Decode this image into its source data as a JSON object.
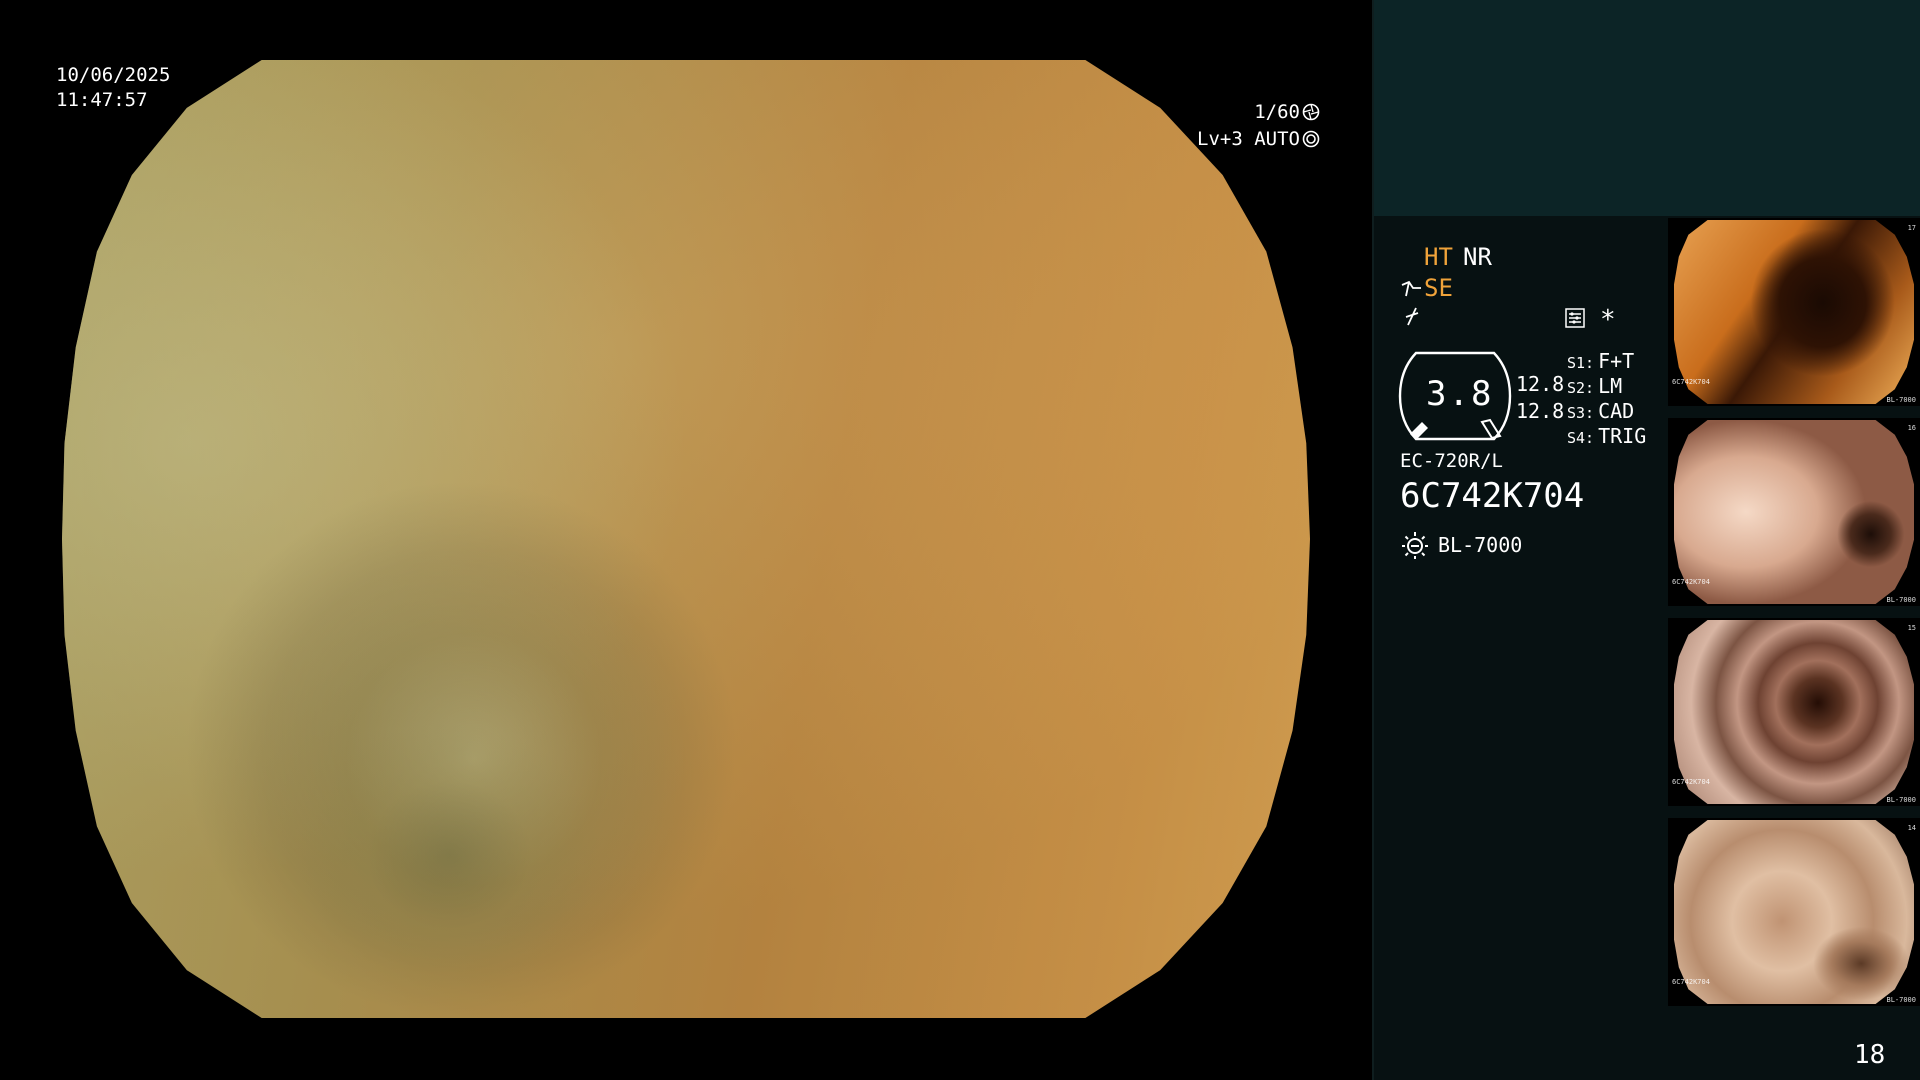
{
  "osd": {
    "date": "10/06/2025",
    "time": "11:47:57",
    "shutter": "1/60",
    "level": "Lv+3 AUTO"
  },
  "panel": {
    "ht": "HT",
    "nr": "NR",
    "se": "SE",
    "star": "*",
    "gauge_value": "3.8",
    "value_1": "12.8",
    "value_2": "12.8",
    "switches": [
      {
        "key": "S1:",
        "label": "F+T"
      },
      {
        "key": "S2:",
        "label": "LM"
      },
      {
        "key": "S3:",
        "label": "CAD"
      },
      {
        "key": "S4:",
        "label": "TRIG"
      }
    ],
    "scope_model": "EC-720R/L",
    "scope_serial": "6C742K704",
    "light_source": "BL-7000",
    "page_number": "18"
  },
  "thumbnails": [
    {
      "serial": "6C742K704",
      "light": "BL-7000",
      "index": "17"
    },
    {
      "serial": "6C742K704",
      "light": "BL-7000",
      "index": "16"
    },
    {
      "serial": "6C742K704",
      "light": "BL-7000",
      "index": "15"
    },
    {
      "serial": "6C742K704",
      "light": "BL-7000",
      "index": "14"
    }
  ],
  "colors": {
    "accent": "#f0a33a",
    "panel_bg": "#071112",
    "band_bg": "#0c2426"
  },
  "icons": [
    "shutter-icon",
    "auto-iris-icon",
    "structure-enhance-icon",
    "filter-icon",
    "memo-icon",
    "light-source-icon"
  ]
}
